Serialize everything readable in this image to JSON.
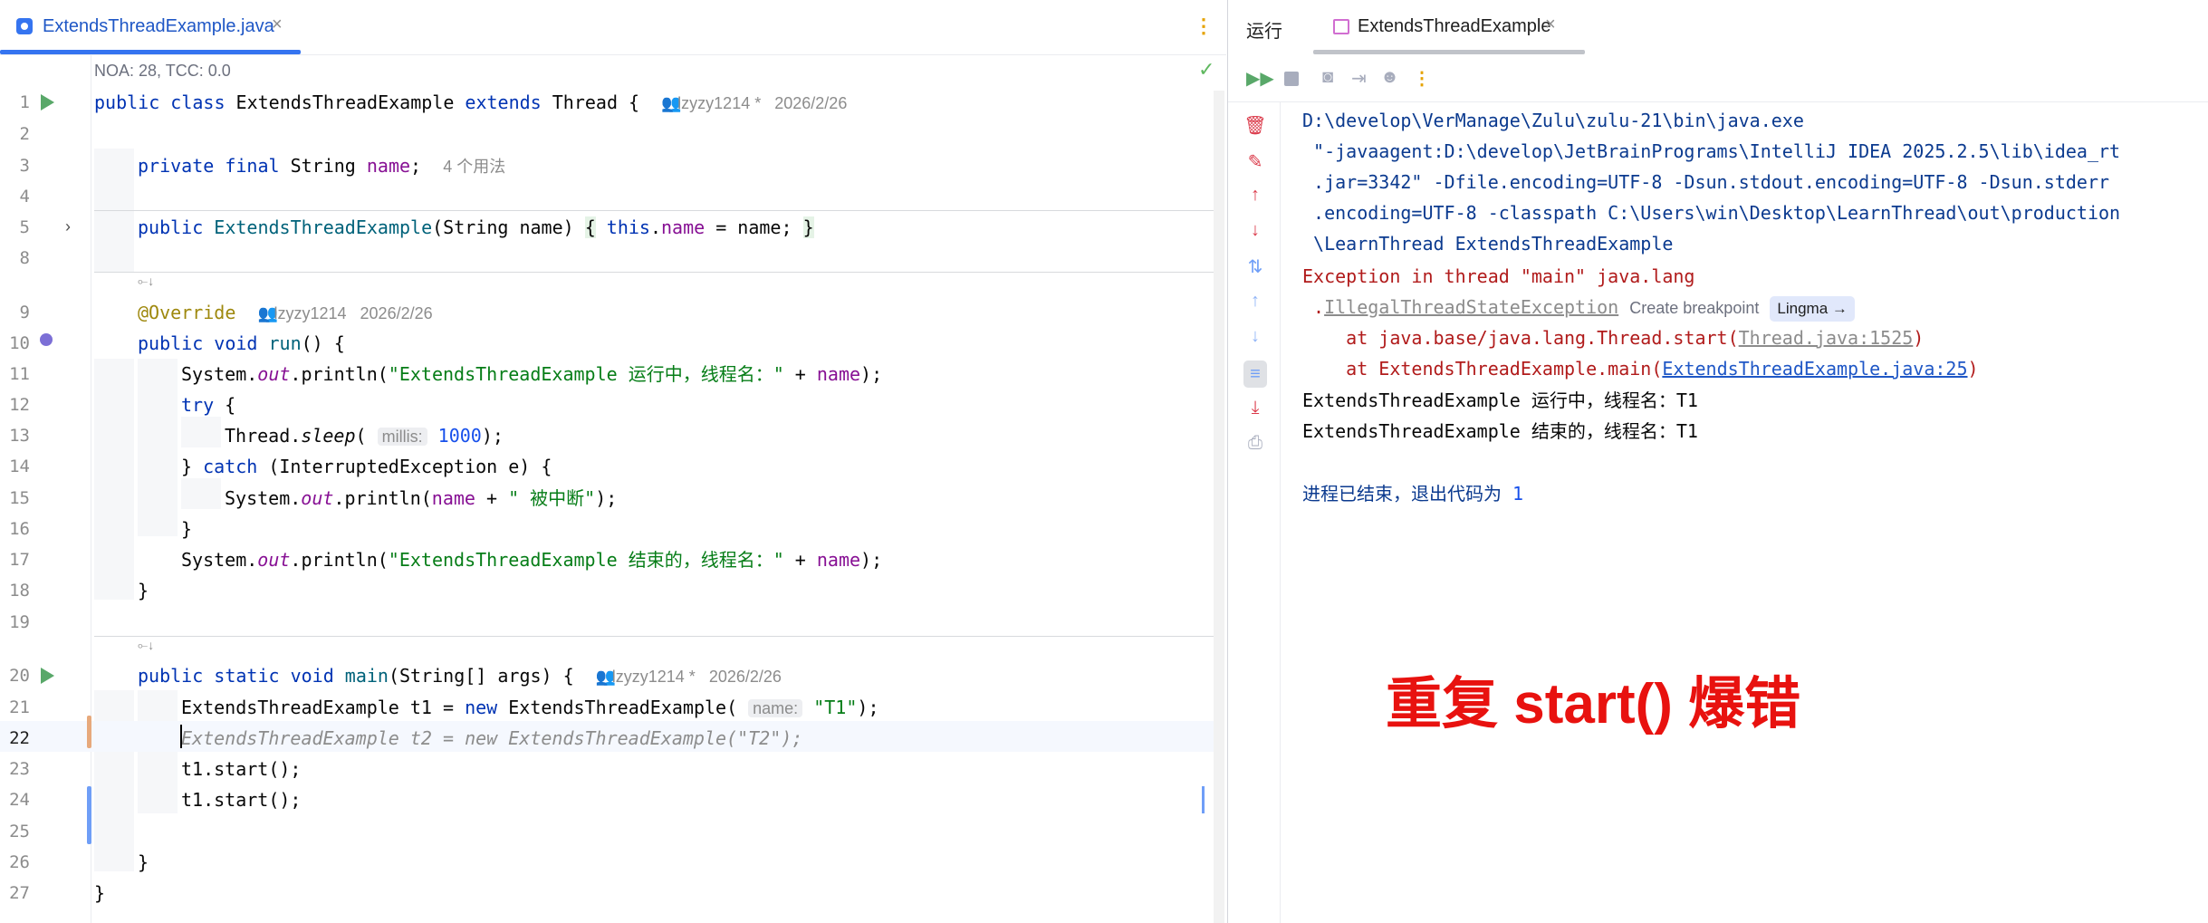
{
  "editor": {
    "tab_label": "ExtendsThreadExample.java",
    "close_glyph": "×",
    "more_glyph": "⋮",
    "metrics": "NOA: 28, TCC: 0.0",
    "check_glyph": "✓",
    "line_numbers": [
      "1",
      "2",
      "3",
      "4",
      "5",
      "8",
      "9",
      "10",
      "11",
      "12",
      "13",
      "14",
      "15",
      "16",
      "17",
      "18",
      "19",
      "20",
      "21",
      "22",
      "23",
      "24",
      "25",
      "26",
      "27"
    ],
    "code": {
      "l1_kw1": "public class",
      "l1_name": " ExtendsThreadExample ",
      "l1_kw2": "extends",
      "l1_rest": " Thread {",
      "l1_author": "lzyzy1214 *",
      "l1_date": "2026/2/26",
      "l3_kw": "private final",
      "l3_type": " String ",
      "l3_field": "name",
      "l3_semi": ";",
      "l3_usages": "4 个用法",
      "l5_kw": "public",
      "l5_ctor": " ExtendsThreadExample",
      "l5_params": "(String name) ",
      "l5_ob": "{",
      "l5_this": " this",
      "l5_dot": ".",
      "l5_field": "name",
      "l5_assign": " = name; ",
      "l5_cb": "}",
      "l9_ann": "@Override",
      "l9_author": "lzyzy1214",
      "l9_date": "2026/2/26",
      "l10_kw": "public void",
      "l10_fn": " run",
      "l10_rest": "() {",
      "l11_a": "System.",
      "l11_out": "out",
      "l11_b": ".println(",
      "l11_str": "\"ExtendsThreadExample 运行中，线程名：\"",
      "l11_plus": " + ",
      "l11_field": "name",
      "l11_end": ");",
      "l12_kw": "try",
      "l12_rest": " {",
      "l13_a": "Thread.",
      "l13_sleep": "sleep",
      "l13_b": "( ",
      "l13_hint": "millis:",
      "l13_num": " 1000",
      "l13_end": ");",
      "l14_a": "} ",
      "l14_kw": "catch",
      "l14_rest": " (InterruptedException e) {",
      "l15_a": "System.",
      "l15_out": "out",
      "l15_b": ".println(",
      "l15_field": "name",
      "l15_plus": " + ",
      "l15_str": "\" 被中断\"",
      "l15_end": ");",
      "l16": "}",
      "l17_a": "System.",
      "l17_out": "out",
      "l17_b": ".println(",
      "l17_str": "\"ExtendsThreadExample 结束的，线程名：\"",
      "l17_plus": " + ",
      "l17_field": "name",
      "l17_end": ");",
      "l18": "}",
      "l20_kw": "public static void",
      "l20_fn": " main",
      "l20_rest": "(String[] args) {",
      "l20_author": "lzyzy1214 *",
      "l20_date": "2026/2/26",
      "l21_a": "ExtendsThreadExample t1 = ",
      "l21_kw": "new",
      "l21_b": " ExtendsThreadExample( ",
      "l21_hint": "name:",
      "l21_str": " \"T1\"",
      "l21_end": ");",
      "l22": "ExtendsThreadExample t2 = new ExtendsThreadExample(\"T2\");",
      "l23": "t1.start();",
      "l24": "t1.start();",
      "l26": "}",
      "l27": "}"
    }
  },
  "run_panel": {
    "title": "运行",
    "tab_label": "ExtendsThreadExample",
    "close_glyph": "×",
    "console": {
      "c1": "D:\\develop\\VerManage\\Zulu\\zulu-21\\bin\\java.exe",
      "c2": " \"-javaagent:D:\\develop\\JetBrainPrograms\\IntelliJ IDEA 2025.2.5\\lib\\idea_rt",
      "c3": " .jar=3342\" -Dfile.encoding=UTF-8 -Dsun.stdout.encoding=UTF-8 -Dsun.stderr",
      "c4": " .encoding=UTF-8 -classpath C:\\Users\\win\\Desktop\\LearnThread\\out\\production",
      "c5": " \\LearnThread ExtendsThreadExample",
      "c6": "Exception in thread \"main\" java.lang",
      "c7_dot": " .",
      "c7_exc": "IllegalThreadStateException",
      "c7_bp": "Create breakpoint",
      "c7_lingma": "Lingma →",
      "c8_a": "    at java.base/java.lang.Thread.start(",
      "c8_link": "Thread.java:1525",
      "c8_end": ")",
      "c9_a": "    at ExtendsThreadExample.main(",
      "c9_link": "ExtendsThreadExample.java:25",
      "c9_end": ")",
      "c10": "ExtendsThreadExample 运行中，线程名：T1",
      "c11": "ExtendsThreadExample 结束的，线程名：T1",
      "c12_a": "进程已结束，退出代码为 ",
      "c12_code": "1"
    }
  },
  "overlay_caption": "重复 start() 爆错",
  "colors": {
    "accent": "#3574f0",
    "keyword": "#0033b3",
    "string": "#067d17",
    "field": "#871094",
    "error": "#b11b1b",
    "caption": "#e8120f",
    "run_icon": "#59a869"
  },
  "icons": [
    "java-file-icon",
    "close-icon",
    "more-icon",
    "check-icon",
    "run-icon",
    "fold-arrow-icon",
    "rerun-icon",
    "stop-icon",
    "camera-icon",
    "exit-icon",
    "debug-icon",
    "trash-icon",
    "clear-icon",
    "up-arrow-icon",
    "down-arrow-icon",
    "sort-icon",
    "soft-wrap-icon",
    "scroll-to-end-icon",
    "print-icon"
  ]
}
